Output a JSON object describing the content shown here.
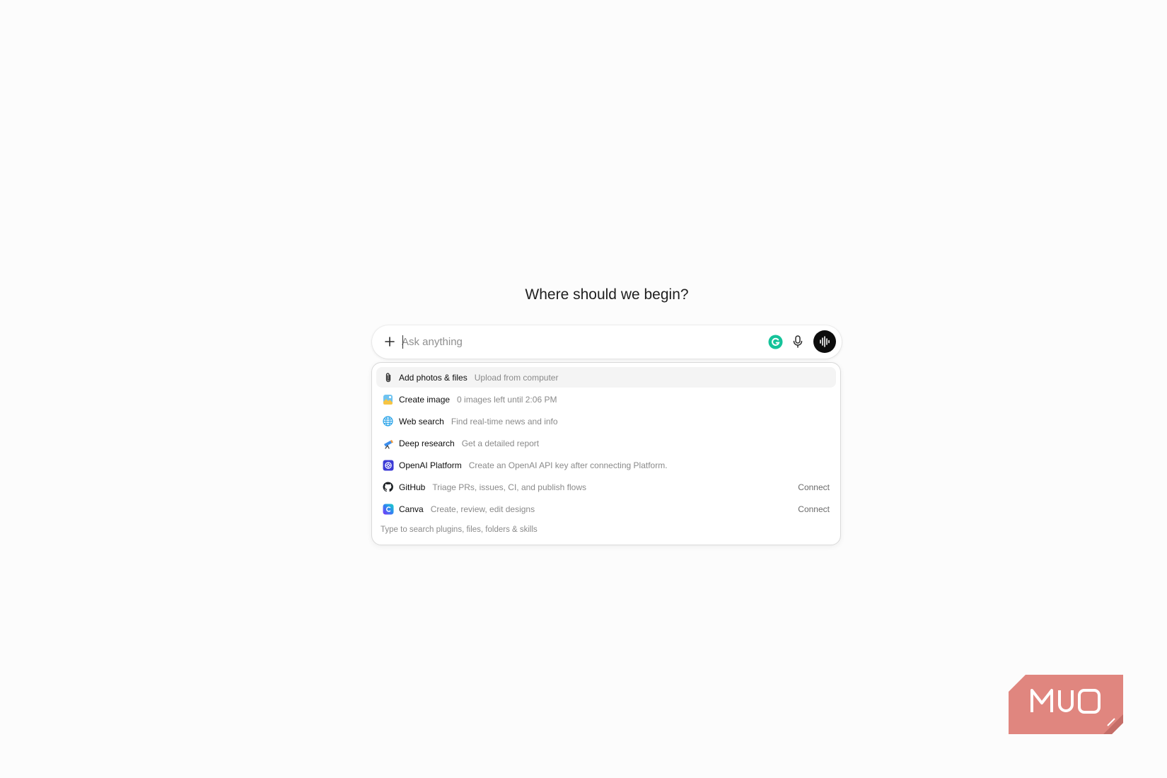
{
  "heading": "Where should we begin?",
  "composer": {
    "placeholder": "Ask anything",
    "icons": [
      "plus-icon",
      "grammarly-icon",
      "microphone-icon",
      "voice-mode-icon"
    ]
  },
  "menu": {
    "items": [
      {
        "icon": "paperclip-icon",
        "label": "Add photos & files",
        "desc": "Upload from computer",
        "action": ""
      },
      {
        "icon": "create-image-icon",
        "label": "Create image",
        "desc": "0 images left until 2:06 PM",
        "action": ""
      },
      {
        "icon": "globe-icon",
        "label": "Web search",
        "desc": "Find real-time news and info",
        "action": ""
      },
      {
        "icon": "telescope-icon",
        "label": "Deep research",
        "desc": "Get a detailed report",
        "action": ""
      },
      {
        "icon": "openai-platform-icon",
        "label": "OpenAI Platform",
        "desc": "Create an OpenAI API key after connecting Platform.",
        "action": ""
      },
      {
        "icon": "github-icon",
        "label": "GitHub",
        "desc": "Triage PRs, issues, CI, and publish flows",
        "action": "Connect"
      },
      {
        "icon": "canva-icon",
        "label": "Canva",
        "desc": "Create, review, edit designs",
        "action": "Connect"
      }
    ],
    "hint": "Type to search plugins, files, folders & skills"
  },
  "watermark": {
    "text": "MUO",
    "color": "#e0867f"
  },
  "colors": {
    "background": "#fcfcfc",
    "voice_button": "#0d0d0d",
    "grammarly": "#15c39a"
  }
}
